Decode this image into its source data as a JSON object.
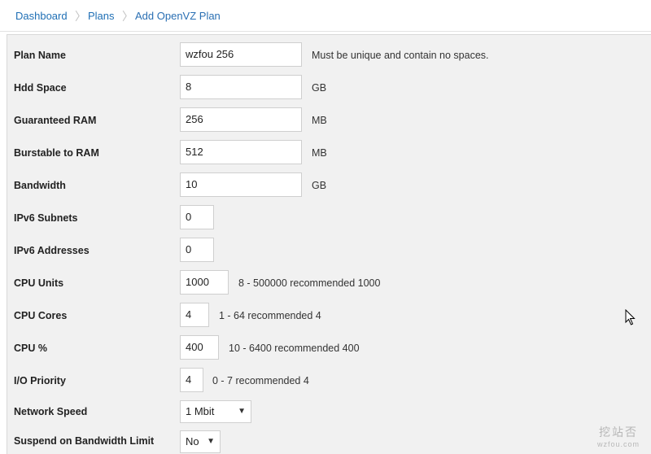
{
  "breadcrumb": {
    "items": [
      "Dashboard",
      "Plans",
      "Add OpenVZ Plan"
    ],
    "separator": "〉"
  },
  "form": {
    "plan_name": {
      "label": "Plan Name",
      "value": "wzfou 256",
      "hint": "Must be unique and contain no spaces."
    },
    "hdd_space": {
      "label": "Hdd Space",
      "value": "8",
      "hint": "GB"
    },
    "guaranteed_ram": {
      "label": "Guaranteed RAM",
      "value": "256",
      "hint": "MB"
    },
    "burstable_ram": {
      "label": "Burstable to RAM",
      "value": "512",
      "hint": "MB"
    },
    "bandwidth": {
      "label": "Bandwidth",
      "value": "10",
      "hint": "GB"
    },
    "ipv6_subnets": {
      "label": "IPv6 Subnets",
      "value": "0"
    },
    "ipv6_addresses": {
      "label": "IPv6 Addresses",
      "value": "0"
    },
    "cpu_units": {
      "label": "CPU Units",
      "value": "1000",
      "hint": "8 - 500000 recommended 1000"
    },
    "cpu_cores": {
      "label": "CPU Cores",
      "value": "4",
      "hint": "1 - 64 recommended 4"
    },
    "cpu_percent": {
      "label": "CPU %",
      "value": "400",
      "hint": "10 - 6400 recommended 400"
    },
    "io_priority": {
      "label": "I/O Priority",
      "value": "4",
      "hint": "0 - 7 recommended 4"
    },
    "network_speed": {
      "label": "Network Speed",
      "value": "1 Mbit"
    },
    "suspend_on_bw": {
      "label": "Suspend on Bandwidth Limit",
      "value": "No"
    }
  },
  "watermark": {
    "text": "挖站否",
    "sub": "wzfou.com"
  }
}
